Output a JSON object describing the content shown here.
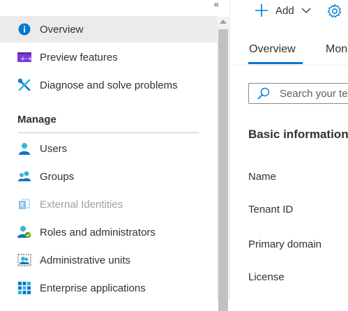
{
  "nav": {
    "collapse_glyph": "«",
    "top_items": [
      {
        "label": "Overview",
        "icon": "info-icon",
        "selected": true
      },
      {
        "label": "Preview features",
        "icon": "preview-features-icon"
      },
      {
        "label": "Diagnose and solve problems",
        "icon": "wrench-icon"
      }
    ],
    "manage_header": "Manage",
    "manage_items": [
      {
        "label": "Users",
        "icon": "user-icon"
      },
      {
        "label": "Groups",
        "icon": "groups-icon"
      },
      {
        "label": "External Identities",
        "icon": "external-identities-icon",
        "disabled": true
      },
      {
        "label": "Roles and administrators",
        "icon": "roles-icon"
      },
      {
        "label": "Administrative units",
        "icon": "admin-units-icon"
      },
      {
        "label": "Enterprise applications",
        "icon": "enterprise-apps-icon"
      }
    ]
  },
  "toolbar": {
    "add_label": "Add",
    "settings_icon": "gear-icon"
  },
  "tabs": [
    {
      "label": "Overview",
      "active": true
    },
    {
      "label": "Mon"
    }
  ],
  "search": {
    "placeholder": "Search your te",
    "value": ""
  },
  "content": {
    "section_title": "Basic information",
    "properties": [
      {
        "label": "Name"
      },
      {
        "label": "Tenant ID"
      },
      {
        "label": "Primary domain"
      },
      {
        "label": "License"
      }
    ]
  },
  "colors": {
    "accent": "#0078d4",
    "selected_bg": "#edebe9",
    "disabled_text": "#a19f9d"
  }
}
